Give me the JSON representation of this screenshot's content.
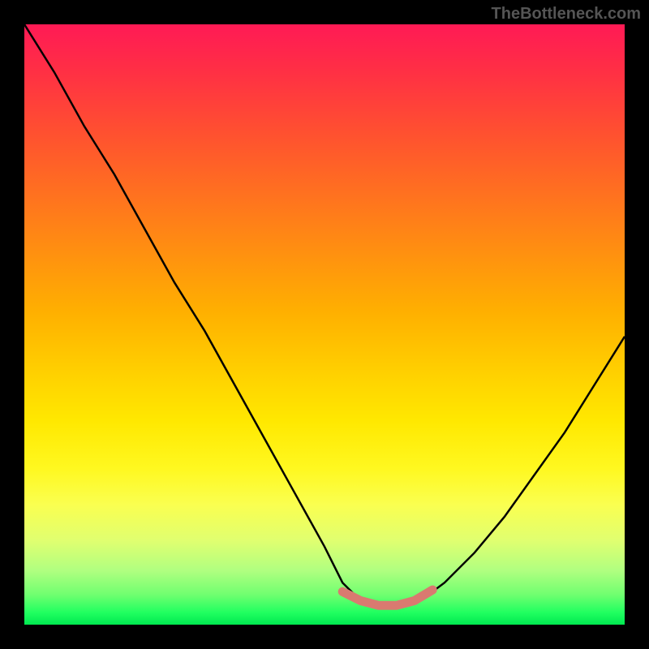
{
  "watermark": "TheBottleneck.com",
  "chart_data": {
    "type": "line",
    "title": "",
    "xlabel": "",
    "ylabel": "",
    "xlim": [
      0,
      100
    ],
    "ylim": [
      0,
      100
    ],
    "series": [
      {
        "name": "bottleneck-curve",
        "x": [
          0,
          5,
          10,
          15,
          20,
          25,
          30,
          35,
          40,
          45,
          50,
          53,
          56,
          60,
          63,
          66,
          70,
          75,
          80,
          85,
          90,
          95,
          100
        ],
        "y": [
          100,
          92,
          83,
          75,
          66,
          57,
          49,
          40,
          31,
          22,
          13,
          7,
          4,
          3,
          3,
          4,
          7,
          12,
          18,
          25,
          32,
          40,
          48
        ]
      },
      {
        "name": "highlight-band",
        "x": [
          53,
          56,
          59,
          62,
          65,
          68
        ],
        "y": [
          5.5,
          4,
          3.2,
          3.2,
          4,
          5.8
        ]
      }
    ],
    "colors": {
      "curve": "#000000",
      "highlight": "#d97a70",
      "gradient_top": "#ff1a55",
      "gradient_bottom": "#00e850"
    }
  }
}
